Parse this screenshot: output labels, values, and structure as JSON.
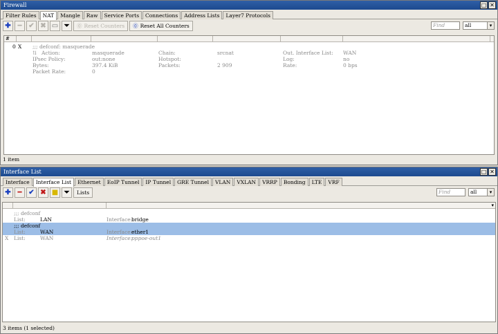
{
  "firewall": {
    "title": "Firewall",
    "tabs": [
      "Filter Rules",
      "NAT",
      "Mangle",
      "Raw",
      "Service Ports",
      "Connections",
      "Address Lists",
      "Layer7 Protocols"
    ],
    "toolbar": {
      "reset_counters": "Reset Counters",
      "reset_all_counters": "Reset All Counters"
    },
    "find_placeholder": "Find",
    "filter_value": "all",
    "header_hash": "#",
    "rule": {
      "number": "0",
      "flag": "X",
      "comment": ";;; defconf: masquerade",
      "action_label": "Action:",
      "action": "masquerade",
      "chain_label": "Chain:",
      "chain": "srcnat",
      "out_if_label": "Out. Interface List:",
      "out_if": "WAN",
      "ipsec_label": "IPsec Policy:",
      "ipsec": "out:none",
      "hotspot_label": "Hotspot:",
      "log_label": "Log:",
      "log": "no",
      "bytes_label": "Bytes:",
      "bytes": "397.4 KiB",
      "packets_label": "Packets:",
      "packets": "2 909",
      "rate_label": "Rate:",
      "rate": "0 bps",
      "packet_rate_label": "Packet Rate:",
      "packet_rate": "0"
    },
    "status": "1 item"
  },
  "interface_list": {
    "title": "Interface List",
    "tabs": [
      "Interface",
      "Interface List",
      "Ethernet",
      "EoIP Tunnel",
      "IP Tunnel",
      "GRE Tunnel",
      "VLAN",
      "VXLAN",
      "VRRP",
      "Bonding",
      "LTE",
      "VRF"
    ],
    "toolbar": {
      "lists": "Lists"
    },
    "find_placeholder": "Find",
    "filter_value": "all",
    "rows": [
      {
        "comment": ";;; defconf",
        "flag": "",
        "list_label": "List:",
        "list": "LAN",
        "if_label": "Interface:",
        "iface": "bridge"
      },
      {
        "comment": ";;; defconf",
        "flag": "",
        "list_label": "List:",
        "list": "WAN",
        "if_label": "Interface:",
        "iface": "ether1"
      },
      {
        "comment": "",
        "flag": "X",
        "list_label": "List:",
        "list": "WAN",
        "if_label": "Interface:",
        "iface": "pppoe-out1"
      }
    ],
    "status": "3 items (1 selected)"
  },
  "colors": {
    "titlebar": "#1d4a8f",
    "selected_row": "#9cbde6",
    "add": "#1a3fbf",
    "remove": "#c01818"
  }
}
